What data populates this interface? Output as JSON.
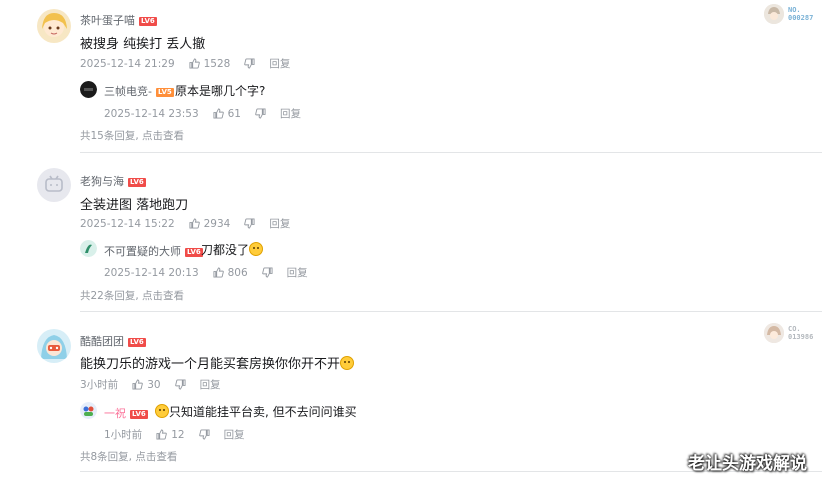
{
  "comments": [
    {
      "user": "茶叶蛋子喵",
      "level": "LV6",
      "content": "被搜身 纯挨打 丢人撤",
      "time": "2025-12-14 21:29",
      "likes": "1528",
      "reply_label": "回复",
      "badge_text": "NO.\n000287",
      "reply": {
        "user": "三帧电竞-",
        "level": "LV5",
        "content": "原本是哪几个字?",
        "time": "2025-12-14 23:53",
        "likes": "61",
        "reply_label": "回复"
      },
      "more": "共15条回复, 点击查看"
    },
    {
      "user": "老狗与海",
      "level": "LV6",
      "content": "全装进图 落地跑刀",
      "time": "2025-12-14 15:22",
      "likes": "2934",
      "reply_label": "回复",
      "reply": {
        "user": "不可置疑的大师",
        "level": "LV6",
        "content": "刀都没了",
        "time": "2025-12-14 20:13",
        "likes": "806",
        "reply_label": "回复"
      },
      "more": "共22条回复, 点击查看"
    },
    {
      "user": "酷酷团团",
      "level": "LV6",
      "content": "能换刀乐的游戏一个月能买套房换你你开不开",
      "time": "3小时前",
      "likes": "30",
      "reply_label": "回复",
      "badge_text": "CO.\n013986",
      "reply": {
        "user": "一祝",
        "level": "LV6",
        "content": "只知道能挂平台卖, 但不去问问谁买",
        "time": "1小时前",
        "likes": "12",
        "reply_label": "回复"
      },
      "more": "共8条回复, 点击查看"
    }
  ],
  "watermark": "老让头游戏解说"
}
